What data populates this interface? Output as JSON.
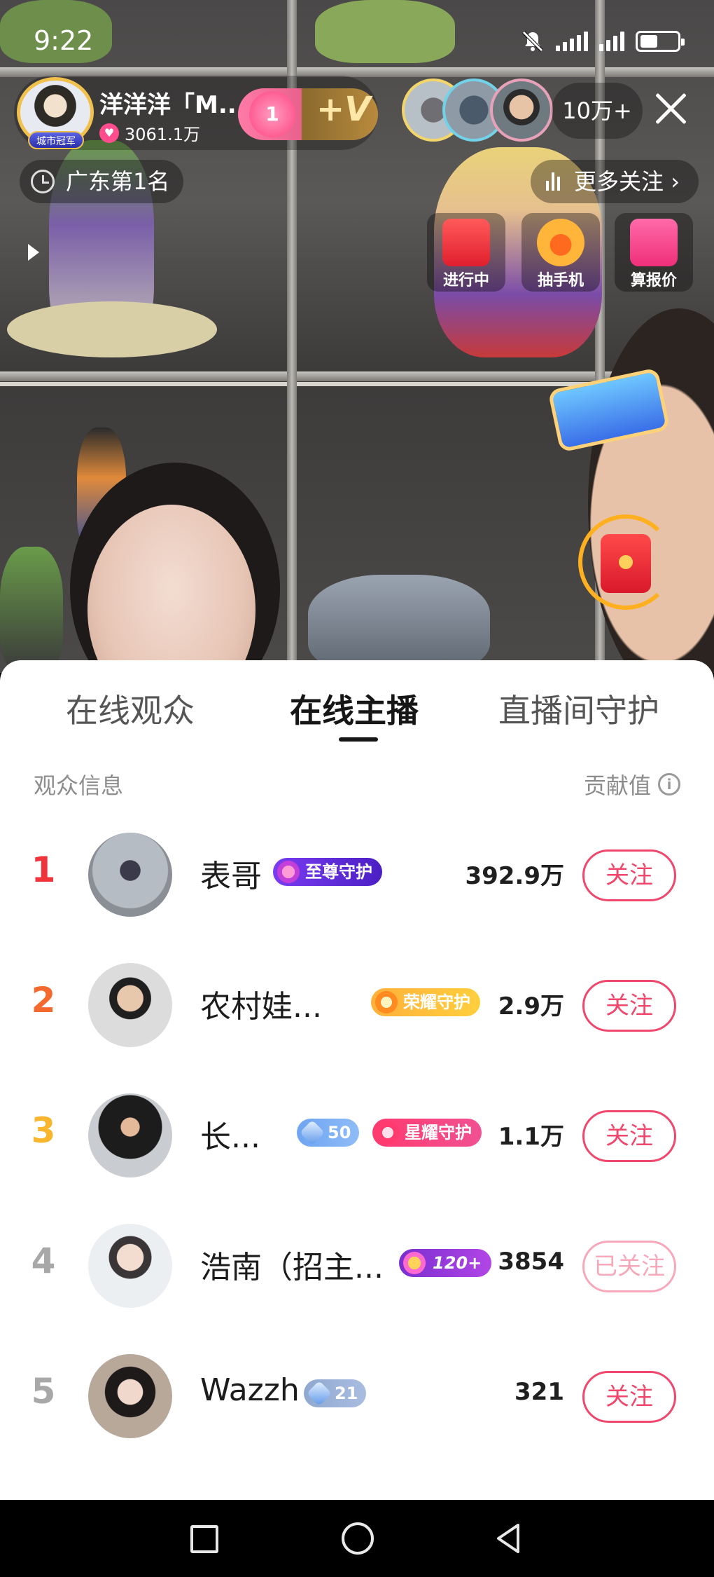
{
  "status_bar": {
    "time": "9:22",
    "icons": [
      "bell-muted-icon",
      "signal-icon",
      "signal-icon",
      "battery-icon"
    ]
  },
  "host": {
    "name": "洋洋洋「M...",
    "likes": "3061.1万",
    "avatar_badge": "城市冠军"
  },
  "fan_club": {
    "level": "1",
    "mark": "+V"
  },
  "viewers": {
    "count": "10万+"
  },
  "stream": {
    "rank_label": "广东第1名",
    "more_follow": "更多关注",
    "features": [
      {
        "label": "进行中"
      },
      {
        "label": "抽手机"
      },
      {
        "label": "算报价"
      }
    ]
  },
  "sheet": {
    "tabs": [
      {
        "label": "在线观众",
        "active": false
      },
      {
        "label": "在线主播",
        "active": true
      },
      {
        "label": "直播间守护",
        "active": false
      }
    ],
    "header_left": "观众信息",
    "header_right": "贡献值",
    "rows": [
      {
        "rank": "1",
        "rank_color": "#f0343c",
        "name": "表哥",
        "badges": [
          {
            "type": "purple",
            "text": "至尊守护"
          }
        ],
        "score": "392.9万",
        "button": "关注",
        "followed": false
      },
      {
        "rank": "2",
        "rank_color": "#f46a2e",
        "name": "农村娃...",
        "badges": [
          {
            "type": "orange",
            "text": "荣耀守护"
          }
        ],
        "score": "2.9万",
        "button": "关注",
        "followed": false
      },
      {
        "rank": "3",
        "rank_color": "#f7b62e",
        "name": "长...",
        "badges": [
          {
            "type": "level",
            "text": "50"
          },
          {
            "type": "pink",
            "text": "星耀守护"
          }
        ],
        "score": "1.1万",
        "button": "关注",
        "followed": false
      },
      {
        "rank": "4",
        "rank_color": "#a8a8a8",
        "name": "浩南（招主...",
        "badges": [
          {
            "type": "level120",
            "text": "120+"
          }
        ],
        "score": "3854",
        "button": "已关注",
        "followed": true
      },
      {
        "rank": "5",
        "rank_color": "#a8a8a8",
        "name": "Wazzh",
        "badges": [
          {
            "type": "levelgray",
            "text": "21"
          }
        ],
        "score": "321",
        "button": "关注",
        "followed": false
      }
    ]
  }
}
